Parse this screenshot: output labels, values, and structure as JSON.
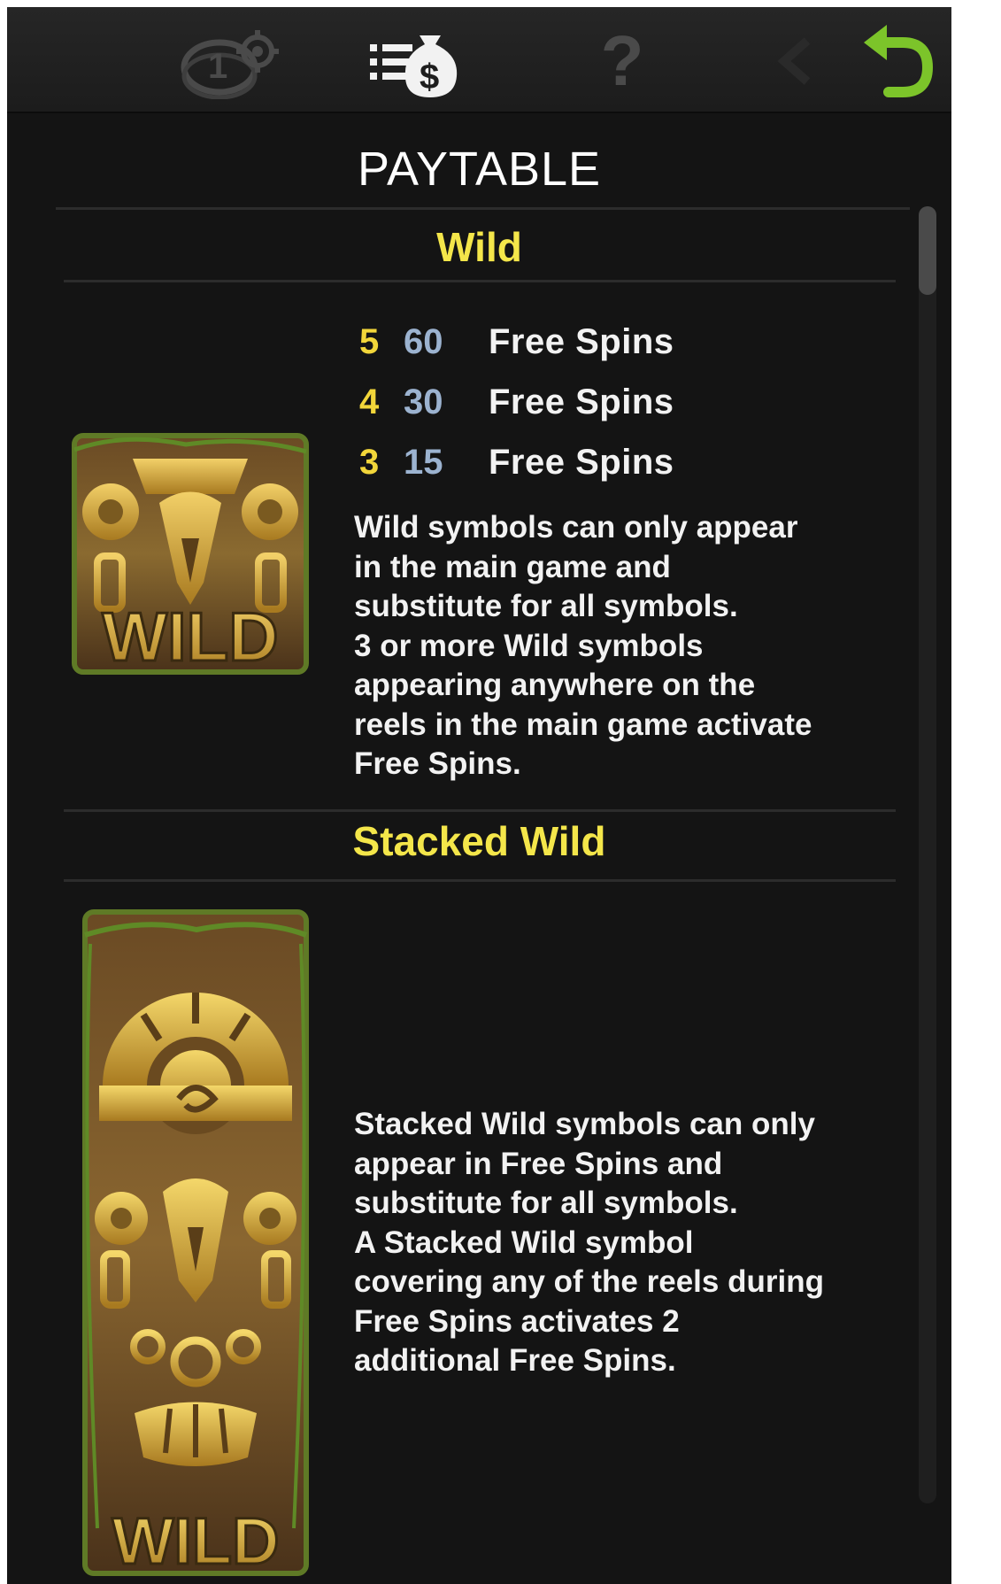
{
  "toolbar": {
    "icons": [
      "autoplay-settings-icon",
      "paytable-icon",
      "help-icon",
      "back-icon",
      "return-icon"
    ],
    "autoplay_digit": "1",
    "help_glyph": "?"
  },
  "paytable": {
    "title": "PAYTABLE",
    "sections": [
      {
        "title": "Wild",
        "pays": [
          {
            "count": "5",
            "value": "60",
            "label": "Free Spins"
          },
          {
            "count": "4",
            "value": "30",
            "label": "Free Spins"
          },
          {
            "count": "3",
            "value": "15",
            "label": "Free Spins"
          }
        ],
        "description": "Wild symbols can only appear\nin the main game and\nsubstitute for all symbols.\n3 or more Wild symbols\nappearing anywhere on the\nreels in the main game activate\nFree Spins.",
        "symbol_label": "WILD"
      },
      {
        "title": "Stacked Wild",
        "description": "Stacked Wild symbols can only\nappear in Free Spins and\nsubstitute for all symbols.\nA Stacked Wild symbol\ncovering any of the reels during\nFree Spins activates 2\nadditional Free Spins.",
        "symbol_label": "WILD"
      }
    ]
  },
  "colors": {
    "background": "#141414",
    "section_title": "#f4e64a",
    "pay_count": "#f2d63a",
    "pay_value": "#9cb3d0",
    "return_icon": "#7cc42a"
  }
}
